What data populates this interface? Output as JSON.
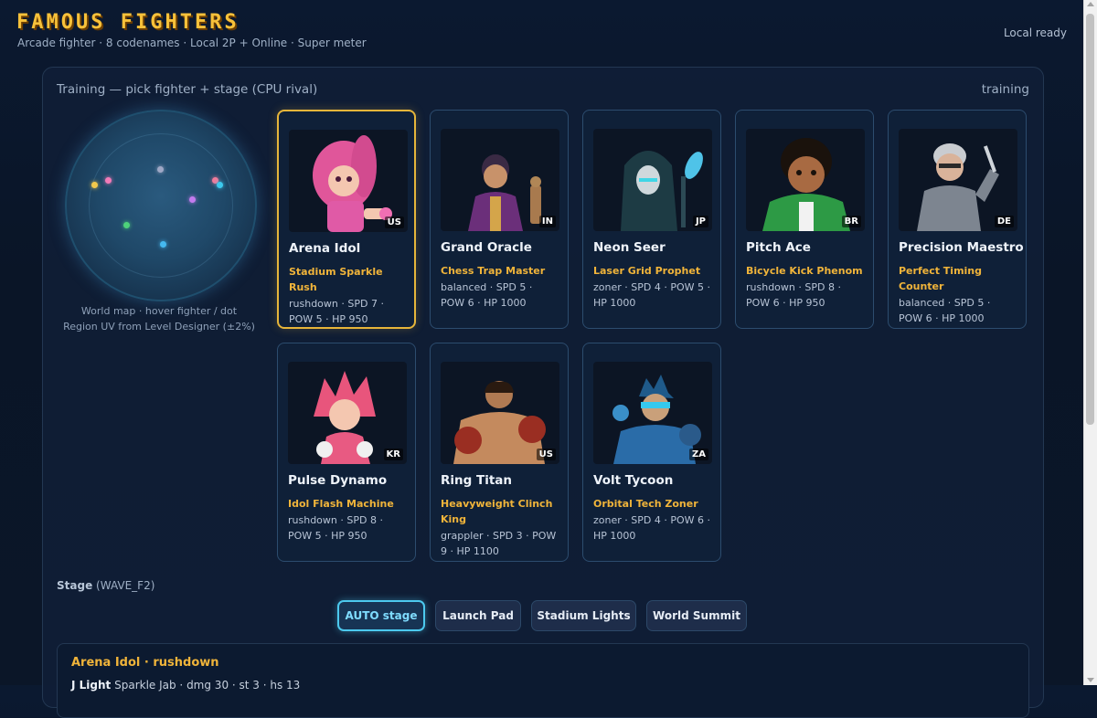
{
  "header": {
    "title": "FAMOUS FIGHTERS",
    "subtitle": "Arcade fighter · 8 codenames · Local 2P + Online · Super meter",
    "status": "Local ready"
  },
  "panel": {
    "title": "Training — pick fighter + stage (CPU rival)",
    "mode": "training"
  },
  "world_map": {
    "caption_line1": "World map · hover fighter / dot",
    "caption_line2": "Region UV from Level Designer (±2%)",
    "dot_colors": [
      "#f2c94c",
      "#f27bb8",
      "#9fa8c6",
      "#f27b9b",
      "#3cc9ee",
      "#c27bee",
      "#4ed27a",
      "#45b9f0"
    ]
  },
  "fighters": [
    {
      "name": "Arena Idol",
      "title": "Stadium Sparkle Rush",
      "stats": "rushdown · SPD 7 · POW 5 · HP 950",
      "flag": "US",
      "selected": true
    },
    {
      "name": "Grand Oracle",
      "title": "Chess Trap Master",
      "stats": "balanced · SPD 5 · POW 6 · HP 1000",
      "flag": "IN"
    },
    {
      "name": "Neon Seer",
      "title": "Laser Grid Prophet",
      "stats": "zoner · SPD 4 · POW 5 · HP 1000",
      "flag": "JP"
    },
    {
      "name": "Pitch Ace",
      "title": "Bicycle Kick Phenom",
      "stats": "rushdown · SPD 8 · POW 6 · HP 950",
      "flag": "BR"
    },
    {
      "name": "Precision Maestro",
      "title": "Perfect Timing Counter",
      "stats": "balanced · SPD 5 · POW 6 · HP 1000",
      "flag": "DE"
    },
    {
      "name": "Pulse Dynamo",
      "title": "Idol Flash Machine",
      "stats": "rushdown · SPD 8 · POW 5 · HP 950",
      "flag": "KR"
    },
    {
      "name": "Ring Titan",
      "title": "Heavyweight Clinch King",
      "stats": "grappler · SPD 3 · POW 9 · HP 1100",
      "flag": "US"
    },
    {
      "name": "Volt Tycoon",
      "title": "Orbital Tech Zoner",
      "stats": "zoner · SPD 4 · POW 6 · HP 1000",
      "flag": "ZA"
    }
  ],
  "stage": {
    "label": "Stage",
    "code": "(WAVE_F2)",
    "buttons": [
      "AUTO stage",
      "Launch Pad",
      "Stadium Lights",
      "World Summit"
    ],
    "active_index": 0
  },
  "moves": {
    "heading": "Arena Idol · rushdown",
    "first_move_key": "J Light",
    "first_move_detail": "Sparkle Jab · dmg 30 · st 3 · hs 13"
  },
  "colors": {
    "accent_gold": "#f0b43a",
    "accent_cyan": "#4cc9ee",
    "background": "#0b1930"
  }
}
